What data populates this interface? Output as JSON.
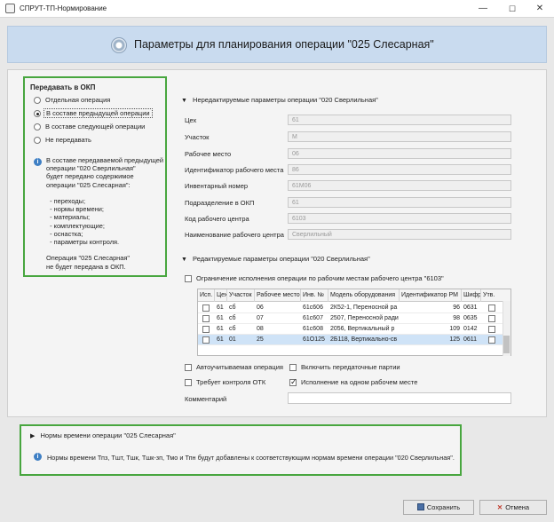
{
  "window": {
    "title": "СПРУТ-ТП-Нормирование",
    "min": "—",
    "max": "☐",
    "close": "✕"
  },
  "banner": {
    "heading": "Параметры для планирования операции \"025 Слесарная\""
  },
  "transfer": {
    "title": "Передавать в ОКП",
    "options": [
      {
        "label": "Отдельная операция",
        "checked": false
      },
      {
        "label": "В составе предыдущей операции",
        "checked": true
      },
      {
        "label": "В составе следующей операции",
        "checked": false
      },
      {
        "label": "Не передавать",
        "checked": false
      }
    ],
    "info": "В составе передаваемой предыдущей\nоперации \"020 Сверлильная\"\nбудет передано содержимое\nоперации \"025 Слесарная\":\n\n  - переходы;\n  - нормы времени;\n  - материалы;\n  - комплектующие;\n  - оснастка;\n  - параметры контроля.\n\nОперация \"025 Слесарная\"\nне будет передана в ОКП."
  },
  "readonly": {
    "title": "Нередактируемые параметры операции \"020 Сверлильная\"",
    "fields": [
      {
        "label": "Цех",
        "value": "61"
      },
      {
        "label": "Участок",
        "value": "М"
      },
      {
        "label": "Рабочее место",
        "value": "06"
      },
      {
        "label": "Идентификатор рабочего места",
        "value": "86"
      },
      {
        "label": "Инвентарный номер",
        "value": "61М06"
      },
      {
        "label": "Подразделение в ОКП",
        "value": "61"
      },
      {
        "label": "Код рабочего центра",
        "value": "6103"
      },
      {
        "label": "Наименование рабочего центра",
        "value": "Сверлильный"
      }
    ]
  },
  "editable": {
    "title": "Редактируемые параметры операции \"020 Сверлильная\"",
    "restrict_label": "Ограничение исполнения операции по рабочим местам рабочего центра \"6103\"",
    "columns": [
      "Исп.",
      "Цех",
      "Участок",
      "Рабочее место",
      "Инв. №",
      "Модель оборудования",
      "Идентификатор РМ",
      "Шифр",
      "Утв."
    ],
    "rows": [
      {
        "shop": "61",
        "area": "сб",
        "place": "06",
        "inv": "61с606",
        "model": "2К52-1, Переносной ра",
        "id": "96",
        "code": "0631"
      },
      {
        "shop": "61",
        "area": "сб",
        "place": "07",
        "inv": "61с607",
        "model": "2507, Переносной ради",
        "id": "98",
        "code": "0635"
      },
      {
        "shop": "61",
        "area": "сб",
        "place": "08",
        "inv": "61с608",
        "model": "2056, Вертикальный р",
        "id": "109",
        "code": "0142"
      },
      {
        "shop": "61",
        "area": "01",
        "place": "25",
        "inv": "61О125",
        "model": "2Б118, Вертикально-св",
        "id": "125",
        "code": "0611"
      }
    ],
    "auto_label": "Автоучитываемая операция",
    "include_label": "Включить передаточные партии",
    "otk_label": "Требует контроля ОТК",
    "single_label": "Исполнение на одном рабочем месте",
    "comment_label": "Комментарий"
  },
  "norms": {
    "title": "Нормы времени операции \"025 Слесарная\"",
    "info": "Нормы времени Тпз, Тшт, Тшк, Тшк-зп, Тмо и Тпн будут добавлены к соответствующим нормам времени операции \"020 Сверлильная\"."
  },
  "buttons": {
    "save": "Сохранить",
    "cancel": "Отмена"
  },
  "colors": {
    "highlight_border": "#48a63f",
    "banner": "#c9dbef",
    "info": "#3e7fc4"
  }
}
